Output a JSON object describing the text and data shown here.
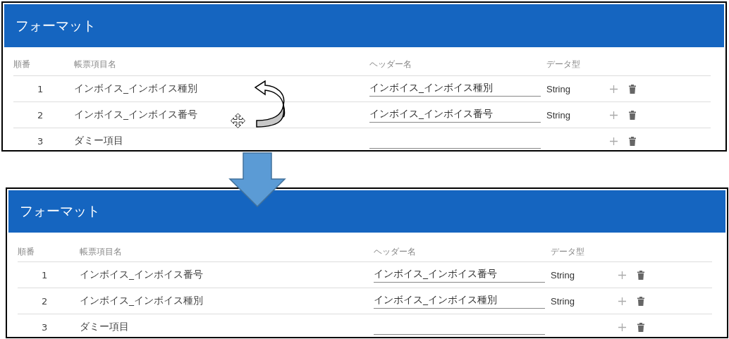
{
  "panels": [
    {
      "title": "フォーマット",
      "columns": [
        "順番",
        "帳票項目名",
        "ヘッダー名",
        "データ型"
      ],
      "rows": [
        {
          "order": "1",
          "item_name": "インボイス_インボイス種別",
          "header_name": "インボイス_インボイス種別",
          "data_type": "String"
        },
        {
          "order": "2",
          "item_name": "インボイス_インボイス番号",
          "header_name": "インボイス_インボイス番号",
          "data_type": "String"
        },
        {
          "order": "3",
          "item_name": "ダミー項目"
        }
      ]
    },
    {
      "title": "フォーマット",
      "columns": [
        "順番",
        "帳票項目名",
        "ヘッダー名",
        "データ型"
      ],
      "rows": [
        {
          "order": "1",
          "item_name": "インボイス_インボイス番号",
          "header_name": "インボイス_インボイス番号",
          "data_type": "String"
        },
        {
          "order": "2",
          "item_name": "インボイス_インボイス種別",
          "header_name": "インボイス_インボイス種別",
          "data_type": "String"
        },
        {
          "order": "3",
          "item_name": "ダミー項目"
        }
      ]
    }
  ]
}
